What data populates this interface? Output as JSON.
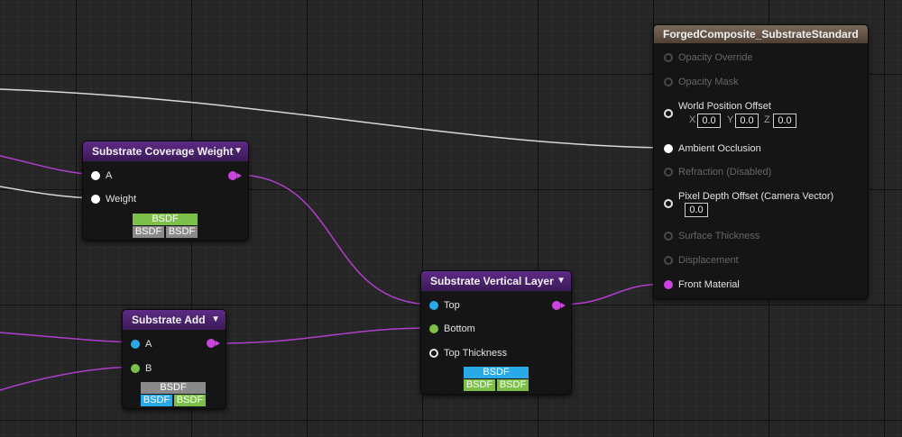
{
  "nodes": {
    "coverage": {
      "title": "Substrate Coverage Weight",
      "inputs": [
        "A",
        "Weight"
      ],
      "output_tag": "BSDF",
      "input_tags": [
        "BSDF",
        "BSDF"
      ]
    },
    "add": {
      "title": "Substrate Add",
      "inputs": [
        "A",
        "B"
      ],
      "output_tag": "BSDF",
      "input_tags": [
        "BSDF",
        "BSDF"
      ]
    },
    "vertical": {
      "title": "Substrate Vertical Layer",
      "inputs": [
        "Top",
        "Bottom",
        "Top Thickness"
      ],
      "output_tag": "BSDF",
      "input_tags": [
        "BSDF",
        "BSDF"
      ]
    },
    "result": {
      "title": "ForgedComposite_SubstrateStandard",
      "pins": {
        "opacity_override": "Opacity Override",
        "opacity_mask": "Opacity Mask",
        "world_position_offset": "World Position Offset",
        "ambient_occlusion": "Ambient Occlusion",
        "refraction": "Refraction (Disabled)",
        "pixel_depth_offset": "Pixel Depth Offset (Camera Vector)",
        "surface_thickness": "Surface Thickness",
        "displacement": "Displacement",
        "front_material": "Front Material"
      },
      "wpo": {
        "x_label": "X",
        "y_label": "Y",
        "z_label": "Z",
        "x": "0.0",
        "y": "0.0",
        "z": "0.0"
      },
      "pdo_value": "0.0"
    }
  },
  "colors": {
    "bsdf_wire": "#b03ecc",
    "white_wire": "#d8d8d8",
    "substrate_header": "#5e2b86",
    "result_header": "#7a6a5a"
  }
}
